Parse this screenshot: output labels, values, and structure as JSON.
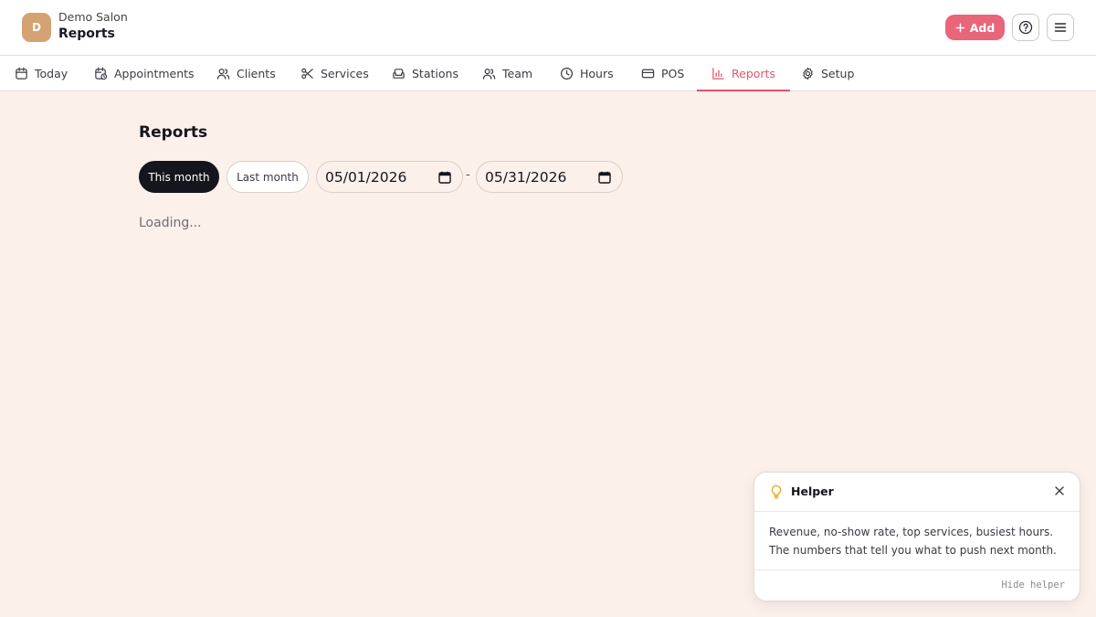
{
  "header": {
    "avatar_letter": "D",
    "salon_name": "Demo Salon",
    "page_title": "Reports",
    "add_label": "Add"
  },
  "tabs": [
    {
      "label": "Today",
      "icon": "calendar-icon"
    },
    {
      "label": "Appointments",
      "icon": "calendar-clock-icon"
    },
    {
      "label": "Clients",
      "icon": "users-icon"
    },
    {
      "label": "Services",
      "icon": "scissors-icon"
    },
    {
      "label": "Stations",
      "icon": "armchair-icon"
    },
    {
      "label": "Team",
      "icon": "team-icon"
    },
    {
      "label": "Hours",
      "icon": "clock-icon"
    },
    {
      "label": "POS",
      "icon": "credit-card-icon"
    },
    {
      "label": "Reports",
      "icon": "bar-chart-icon",
      "active": true
    },
    {
      "label": "Setup",
      "icon": "gear-icon"
    }
  ],
  "main": {
    "title": "Reports",
    "filters": {
      "this_month": "This month",
      "last_month": "Last month",
      "start_date": "05/01/2026",
      "separator": "-",
      "end_date": "05/31/2026"
    },
    "loading": "Loading..."
  },
  "helper": {
    "title": "Helper",
    "body": "Revenue, no-show rate, top services, busiest hours. The numbers that tell you what to push next month.",
    "hide_label": "Hide helper"
  },
  "colors": {
    "accent": "#e0566d",
    "add_button": "#e8657a",
    "background": "#fcf0eb",
    "avatar": "#d4a373",
    "dark_pill": "#15151d"
  }
}
